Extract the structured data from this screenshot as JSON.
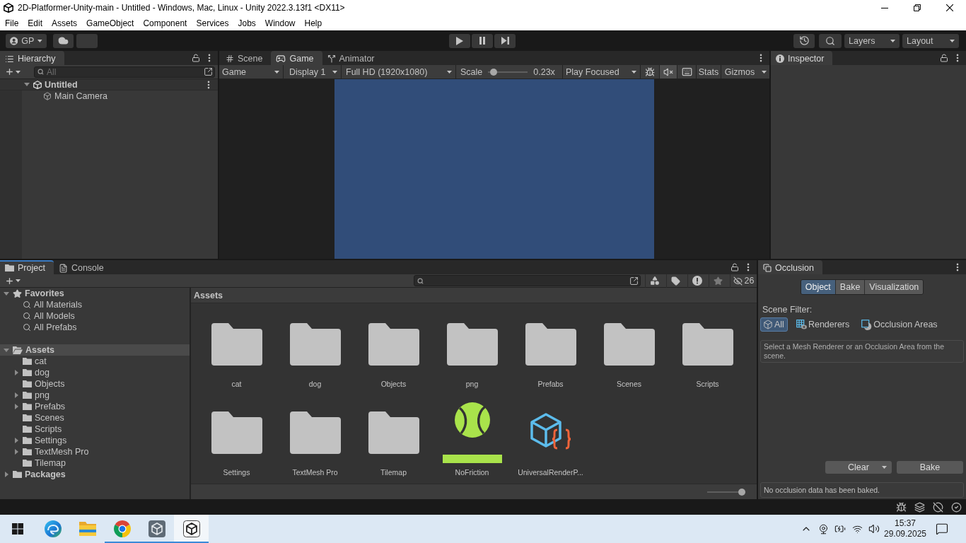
{
  "window": {
    "title": "2D-Platformer-Unity-main - Untitled - Windows, Mac, Linux - Unity 2022.3.13f1 <DX11>"
  },
  "menu": [
    "File",
    "Edit",
    "Assets",
    "GameObject",
    "Component",
    "Services",
    "Jobs",
    "Window",
    "Help"
  ],
  "toolbar": {
    "account": "GP",
    "layers": "Layers",
    "layout": "Layout"
  },
  "hierarchy": {
    "tab": "Hierarchy",
    "search": {
      "placeholder": "All"
    },
    "tree": [
      {
        "label": "Untitled",
        "kind": "scene",
        "expanded": true,
        "children": [
          {
            "label": "Main Camera",
            "kind": "game_object"
          }
        ]
      }
    ]
  },
  "center_panel": {
    "tabs": [
      {
        "label": "Scene",
        "kind": "scene",
        "selected": false
      },
      {
        "label": "Game",
        "kind": "game",
        "selected": true
      },
      {
        "label": "Animator",
        "kind": "animator",
        "selected": false
      }
    ],
    "toolbar": {
      "view": "Game",
      "display": "Display 1",
      "resolution": "Full HD (1920x1080)",
      "scale_label": "Scale",
      "scale": {
        "level": 0.05
      },
      "scale_reading": "0.23x",
      "play_mode": "Play Focused",
      "toggles": [
        {
          "kind": "bug",
          "on": false
        },
        {
          "kind": "mute",
          "on": true
        },
        {
          "kind": "keyboard",
          "on": false
        }
      ],
      "stats": "Stats",
      "gizmos": "Gizmos"
    }
  },
  "inspector": {
    "tab": "Inspector"
  },
  "project": {
    "focused": true,
    "tabs": [
      {
        "label": "Project",
        "kind": "project",
        "selected": true
      },
      {
        "label": "Console",
        "kind": "console",
        "selected": false
      }
    ],
    "hidden_packages": "26",
    "tree": [
      {
        "label": "Favorites",
        "kind": "favorites",
        "expanded": true,
        "selected": false,
        "children": [
          {
            "label": "All Materials",
            "kind": "search",
            "selected": false
          },
          {
            "label": "All Models",
            "kind": "search",
            "selected": false
          },
          {
            "label": "All Prefabs",
            "kind": "search",
            "selected": false
          }
        ]
      },
      {
        "label": "Assets",
        "kind": "folder",
        "expanded": true,
        "selected": true,
        "children": [
          {
            "label": "cat",
            "kind": "folder",
            "selected": false
          },
          {
            "label": "dog",
            "kind": "folder",
            "expanded": false,
            "selected": false
          },
          {
            "label": "Objects",
            "kind": "folder",
            "selected": false
          },
          {
            "label": "png",
            "kind": "folder",
            "expanded": false,
            "selected": false
          },
          {
            "label": "Prefabs",
            "kind": "folder",
            "expanded": false,
            "selected": false
          },
          {
            "label": "Scenes",
            "kind": "folder",
            "selected": false
          },
          {
            "label": "Scripts",
            "kind": "folder",
            "selected": false
          },
          {
            "label": "Settings",
            "kind": "folder",
            "expanded": false,
            "selected": false
          },
          {
            "label": "TextMesh Pro",
            "kind": "folder",
            "expanded": false,
            "selected": false
          },
          {
            "label": "Tilemap",
            "kind": "folder",
            "selected": false
          }
        ]
      },
      {
        "label": "Packages",
        "kind": "folder",
        "expanded": false,
        "selected": false
      }
    ],
    "breadcrumb": "Assets",
    "assets": [
      {
        "label": "cat",
        "kind": "folder"
      },
      {
        "label": "dog",
        "kind": "folder"
      },
      {
        "label": "Objects",
        "kind": "folder"
      },
      {
        "label": "png",
        "kind": "folder"
      },
      {
        "label": "Prefabs",
        "kind": "folder"
      },
      {
        "label": "Scenes",
        "kind": "folder"
      },
      {
        "label": "Scripts",
        "kind": "folder"
      },
      {
        "label": "Settings",
        "kind": "folder"
      },
      {
        "label": "TextMesh Pro",
        "kind": "folder"
      },
      {
        "label": "Tilemap",
        "kind": "folder"
      },
      {
        "label": "NoFriction",
        "kind": "physics_material"
      },
      {
        "label": "UniversalRenderP...",
        "kind": "pipeline_asset"
      }
    ],
    "icon_size": {
      "level": 1
    }
  },
  "occlusion": {
    "tab": "Occlusion",
    "modes": [
      {
        "label": "Object",
        "selected": true
      },
      {
        "label": "Bake",
        "selected": false
      },
      {
        "label": "Visualization",
        "selected": false
      }
    ],
    "filter_label": "Scene Filter:",
    "filters": [
      {
        "label": "All",
        "kind": "all",
        "selected": true
      },
      {
        "label": "Renderers",
        "kind": "renderers",
        "selected": false
      },
      {
        "label": "Occlusion Areas",
        "kind": "areas",
        "selected": false
      }
    ],
    "help": "Select a Mesh Renderer or an Occlusion Area from the scene.",
    "clear": "Clear",
    "bake": "Bake",
    "status": "No occlusion data has been baked."
  },
  "taskbar": {
    "apps": [
      {
        "kind": "edge",
        "running": false,
        "active": false
      },
      {
        "kind": "explorer",
        "running": false,
        "active": false
      },
      {
        "kind": "chrome",
        "running": true,
        "active": false
      },
      {
        "kind": "unity_hub",
        "running": true,
        "active": false
      },
      {
        "kind": "unity",
        "running": true,
        "active": true
      }
    ],
    "time": "15:37",
    "date": "29.09.2025"
  }
}
